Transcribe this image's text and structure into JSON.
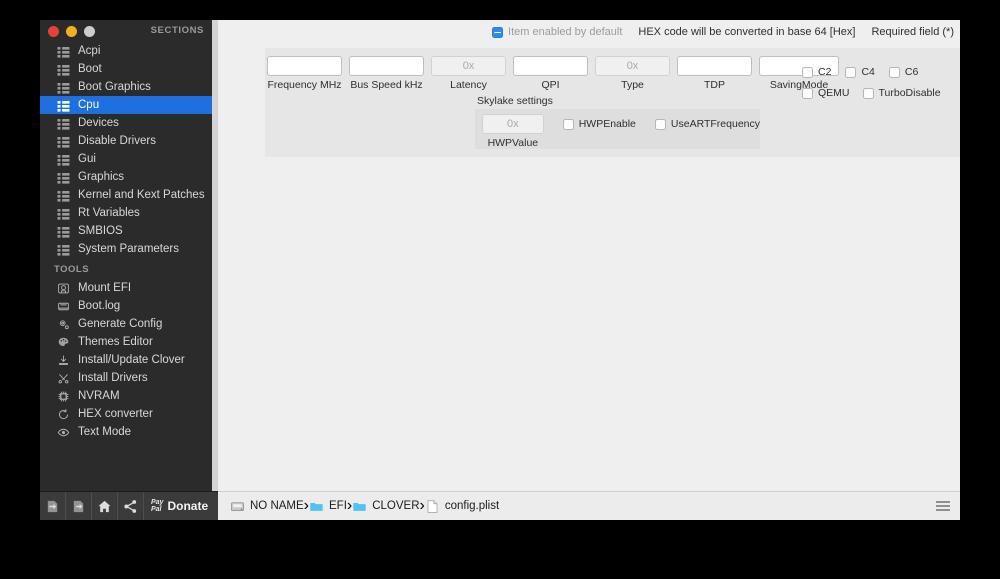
{
  "window": {
    "traffic_lights": [
      "close",
      "minimize",
      "zoom-disabled"
    ],
    "sidebar_header": "SECTIONS"
  },
  "sidebar": {
    "sections_label": "SECTIONS",
    "tools_label": "TOOLS",
    "sections": [
      {
        "label": "Acpi",
        "icon": "list-icon",
        "selected": false
      },
      {
        "label": "Boot",
        "icon": "list-icon",
        "selected": false
      },
      {
        "label": "Boot Graphics",
        "icon": "list-icon",
        "selected": false
      },
      {
        "label": "Cpu",
        "icon": "list-icon",
        "selected": true
      },
      {
        "label": "Devices",
        "icon": "list-icon",
        "selected": false
      },
      {
        "label": "Disable Drivers",
        "icon": "list-icon",
        "selected": false
      },
      {
        "label": "Gui",
        "icon": "list-icon",
        "selected": false
      },
      {
        "label": "Graphics",
        "icon": "list-icon",
        "selected": false
      },
      {
        "label": "Kernel and Kext Patches",
        "icon": "list-icon",
        "selected": false
      },
      {
        "label": "Rt Variables",
        "icon": "list-icon",
        "selected": false
      },
      {
        "label": "SMBIOS",
        "icon": "list-icon",
        "selected": false
      },
      {
        "label": "System Parameters",
        "icon": "list-icon",
        "selected": false
      }
    ],
    "tools": [
      {
        "label": "Mount EFI",
        "icon": "disk-mount-icon"
      },
      {
        "label": "Boot.log",
        "icon": "log-file-icon"
      },
      {
        "label": "Generate Config",
        "icon": "gear-icon"
      },
      {
        "label": "Themes Editor",
        "icon": "palette-icon"
      },
      {
        "label": "Install/Update Clover",
        "icon": "download-icon"
      },
      {
        "label": "Install Drivers",
        "icon": "tools-icon"
      },
      {
        "label": "NVRAM",
        "icon": "chip-icon"
      },
      {
        "label": "HEX converter",
        "icon": "refresh-icon"
      },
      {
        "label": "Text Mode",
        "icon": "eye-icon"
      }
    ]
  },
  "sidebar_toolbar": {
    "buttons": [
      {
        "name": "import-button",
        "icon": "import-icon"
      },
      {
        "name": "export-button",
        "icon": "export-icon"
      },
      {
        "name": "home-button",
        "icon": "home-icon"
      },
      {
        "name": "share-button",
        "icon": "share-icon"
      }
    ],
    "donate": {
      "paypal_line1": "Pay",
      "paypal_line2": "Pal",
      "label": "Donate"
    }
  },
  "notice": {
    "enabled_by_default": "Item enabled by default",
    "hex_note": "HEX code will be converted in base 64 [Hex]",
    "required_note": "Required field (*)"
  },
  "cpu_panel": {
    "fields": [
      {
        "name": "frequency-mhz",
        "label": "Frequency MHz",
        "value": "",
        "placeholder": "",
        "hex": false
      },
      {
        "name": "bus-speed-khz",
        "label": "Bus Speed kHz",
        "value": "",
        "placeholder": "",
        "hex": false
      },
      {
        "name": "latency",
        "label": "Latency",
        "value": "",
        "placeholder": "0x",
        "hex": true
      },
      {
        "name": "qpi",
        "label": "QPI",
        "value": "",
        "placeholder": "",
        "hex": false
      },
      {
        "name": "type",
        "label": "Type",
        "value": "",
        "placeholder": "0x",
        "hex": true
      },
      {
        "name": "tdp",
        "label": "TDP",
        "value": "",
        "placeholder": "",
        "hex": false
      },
      {
        "name": "saving-mode",
        "label": "SavingMode",
        "value": "",
        "placeholder": "",
        "hex": false
      }
    ],
    "cstates": [
      {
        "name": "c2",
        "label": "C2",
        "checked": false
      },
      {
        "name": "c4",
        "label": "C4",
        "checked": false
      },
      {
        "name": "c6",
        "label": "C6",
        "checked": false
      },
      {
        "name": "qemu",
        "label": "QEMU",
        "checked": false
      },
      {
        "name": "turbo-disable",
        "label": "TurboDisable",
        "checked": false
      }
    ],
    "skylake": {
      "title": "Skylake settings",
      "hwpvalue": {
        "label": "HWPValue",
        "value": "",
        "placeholder": "0x"
      },
      "hwpenable": {
        "label": "HWPEnable",
        "checked": false
      },
      "useartfrequency": {
        "label": "UseARTFrequency",
        "checked": false
      }
    }
  },
  "pathbar": {
    "crumbs": [
      {
        "label": "NO NAME",
        "icon": "disk-icon"
      },
      {
        "label": "EFI",
        "icon": "folder-icon"
      },
      {
        "label": "CLOVER",
        "icon": "folder-icon"
      },
      {
        "label": "config.plist",
        "icon": "file-icon"
      }
    ],
    "separator": "›",
    "menu_icon": "hamburger-icon"
  },
  "colors": {
    "accent_selected": "#1e6fe0",
    "checkbox_mixed": "#2c8af0",
    "sidebar_bg": "#2b2b2b",
    "content_bg": "#efefef",
    "panel_bg": "#e6e6e6",
    "folder_blue": "#4fc3f7"
  }
}
